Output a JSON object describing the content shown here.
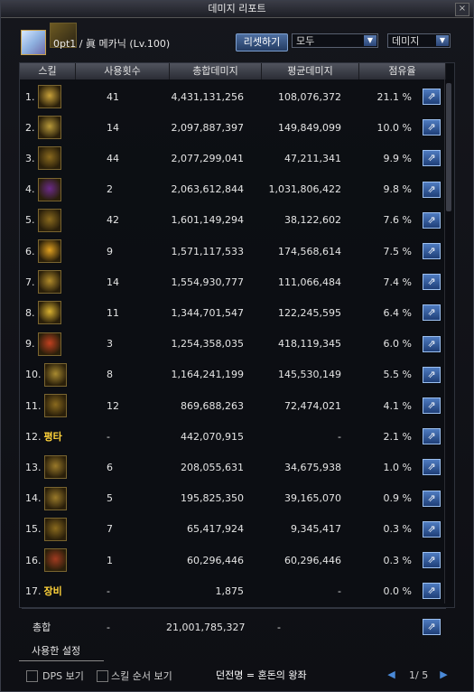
{
  "window": {
    "title": "데미지 리포트",
    "close": "×"
  },
  "header": {
    "player": "0pt1 / 眞 메카닉 (Lv.100)",
    "reset": "리셋하기",
    "filter1": "모두",
    "filter2": "데미지"
  },
  "columns": [
    "스킬",
    "사용횟수",
    "총합데미지",
    "평균데미지",
    "점유율"
  ],
  "rows": [
    {
      "idx": "1.",
      "icon": "burst-icon",
      "color": "#c9a23a",
      "count": "41",
      "total": "4,431,131,256",
      "avg": "108,076,372",
      "pct": "21.1 %"
    },
    {
      "idx": "2.",
      "icon": "gatling-icon",
      "color": "#b99a3a",
      "count": "14",
      "total": "2,097,887,397",
      "avg": "149,849,099",
      "pct": "10.0 %"
    },
    {
      "idx": "3.",
      "icon": "g3-icon",
      "color": "#8a6a1e",
      "count": "44",
      "total": "2,077,299,041",
      "avg": "47,211,341",
      "pct": "9.9 %"
    },
    {
      "idx": "4.",
      "icon": "mech-icon",
      "color": "#6a2a8a",
      "count": "2",
      "total": "2,063,612,844",
      "avg": "1,031,806,422",
      "pct": "9.8 %"
    },
    {
      "idx": "5.",
      "icon": "g2-icon",
      "color": "#8a6a1e",
      "count": "42",
      "total": "1,601,149,294",
      "avg": "38,122,602",
      "pct": "7.6 %"
    },
    {
      "idx": "6.",
      "icon": "explosion-icon",
      "color": "#e0a020",
      "count": "9",
      "total": "1,571,117,533",
      "avg": "174,568,614",
      "pct": "7.5 %"
    },
    {
      "idx": "7.",
      "icon": "robots-icon",
      "color": "#b08a2a",
      "count": "14",
      "total": "1,554,930,777",
      "avg": "111,066,484",
      "pct": "7.4 %"
    },
    {
      "idx": "8.",
      "icon": "laser-icon",
      "color": "#d8b030",
      "count": "11",
      "total": "1,344,701,547",
      "avg": "122,245,595",
      "pct": "6.4 %"
    },
    {
      "idx": "9.",
      "icon": "fire-robot-icon",
      "color": "#c04020",
      "count": "3",
      "total": "1,254,358,035",
      "avg": "418,119,345",
      "pct": "6.0 %"
    },
    {
      "idx": "10.",
      "icon": "rocket-icon",
      "color": "#a88a30",
      "count": "8",
      "total": "1,164,241,199",
      "avg": "145,530,149",
      "pct": "5.5 %"
    },
    {
      "idx": "11.",
      "icon": "target-icon",
      "color": "#8a6a1e",
      "count": "12",
      "total": "869,688,263",
      "avg": "72,474,021",
      "pct": "4.1 %"
    },
    {
      "idx": "12.",
      "label": "평타",
      "count": "-",
      "total": "442,070,915",
      "avg": "-",
      "pct": "2.1 %"
    },
    {
      "idx": "13.",
      "icon": "gear-icon",
      "color": "#9a7a2a",
      "count": "6",
      "total": "208,055,631",
      "avg": "34,675,938",
      "pct": "1.0 %"
    },
    {
      "idx": "14.",
      "icon": "satellite-icon",
      "color": "#9a7a2a",
      "count": "5",
      "total": "195,825,350",
      "avg": "39,165,070",
      "pct": "0.9 %"
    },
    {
      "idx": "15.",
      "icon": "g1-icon",
      "color": "#8a6a1e",
      "count": "7",
      "total": "65,417,924",
      "avg": "9,345,417",
      "pct": "0.3 %"
    },
    {
      "idx": "16.",
      "icon": "g0-icon",
      "color": "#a03a20",
      "count": "1",
      "total": "60,296,446",
      "avg": "60,296,446",
      "pct": "0.3 %"
    },
    {
      "idx": "17.",
      "label": "장비",
      "count": "-",
      "total": "1,875",
      "avg": "-",
      "pct": "0.0 %"
    }
  ],
  "total": {
    "label": "총합",
    "count": "-",
    "total": "21,001,785,327",
    "avg": "-"
  },
  "settings_tab": "사용한 설정",
  "footer": {
    "dps_label": "DPS 보기",
    "order_label": "스킬 순서 보기",
    "dungeon": "던전명 = 혼돈의 왕좌",
    "page": "1/ 5",
    "prev": "◀",
    "next": "▶"
  }
}
